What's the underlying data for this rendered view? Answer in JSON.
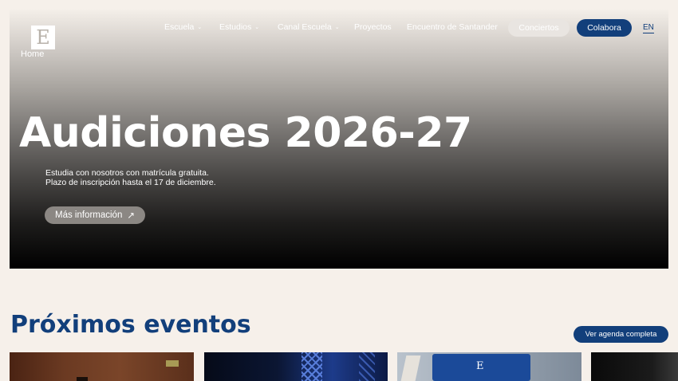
{
  "header": {
    "logo_letter": "E",
    "nav": [
      {
        "label": "Escuela",
        "has_dropdown": true
      },
      {
        "label": "Estudios",
        "has_dropdown": true
      },
      {
        "label": "Canal Escuela",
        "has_dropdown": true
      },
      {
        "label": "Proyectos",
        "has_dropdown": false
      },
      {
        "label": "Encuentro de Santander",
        "has_dropdown": false
      }
    ],
    "conciertos_label": "Conciertos",
    "colabora_label": "Colabora",
    "lang_label": "EN"
  },
  "breadcrumb": "Home",
  "hero": {
    "title": "Audiciones 2026-27",
    "subtitle": "Estudia con nosotros con matrícula gratuita. Plazo de inscripción hasta el 17 de diciembre.",
    "cta_label": "Más información",
    "cta_icon": "↗"
  },
  "events": {
    "title": "Próximos eventos",
    "agenda_label": "Ver agenda completa",
    "card3_logo_letter": "E"
  },
  "colors": {
    "brand": "#123f7b",
    "background": "#f6f0ea"
  }
}
